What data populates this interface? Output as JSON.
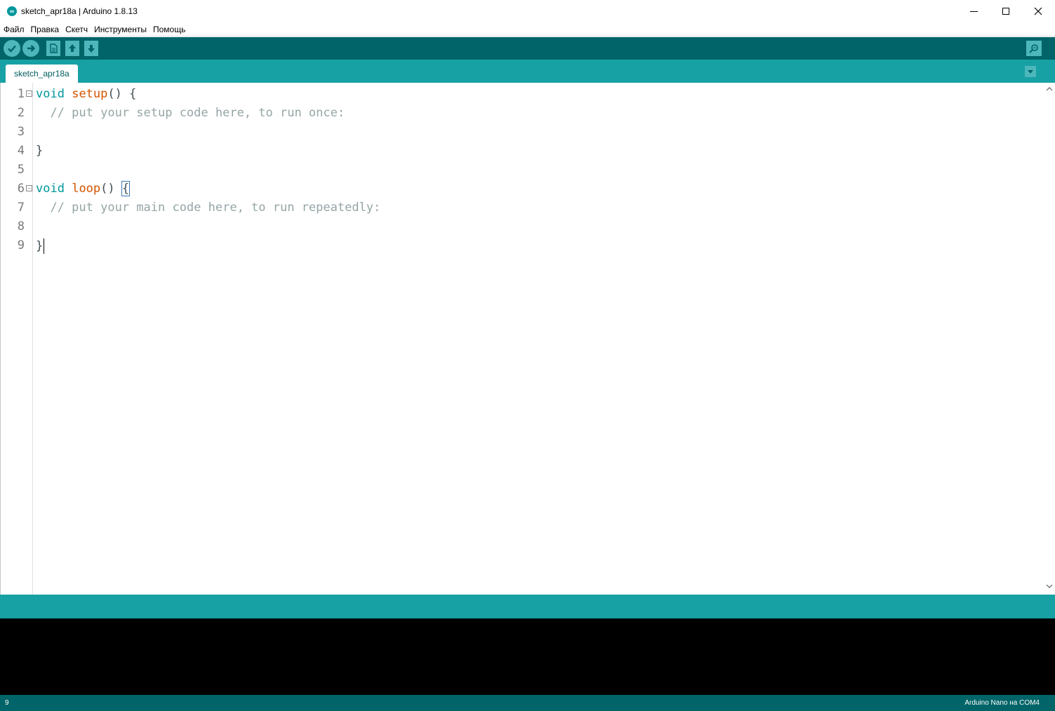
{
  "window": {
    "title": "sketch_apr18a | Arduino 1.8.13",
    "icon": "arduino-icon",
    "controls": [
      "minimize-icon",
      "maximize-icon",
      "close-icon"
    ]
  },
  "menu": {
    "items": [
      "Файл",
      "Правка",
      "Скетч",
      "Инструменты",
      "Помощь"
    ]
  },
  "toolbar": {
    "buttons": [
      "verify-icon",
      "upload-icon",
      "new-icon",
      "open-icon",
      "save-icon"
    ],
    "right_button": "serial-monitor-icon"
  },
  "tabs": {
    "items": [
      {
        "label": "sketch_apr18a",
        "active": true
      }
    ],
    "menu_icon": "tab-menu-icon"
  },
  "editor": {
    "line_numbers": [
      "1",
      "2",
      "3",
      "4",
      "5",
      "6",
      "7",
      "8",
      "9"
    ],
    "lines": {
      "l1": {
        "kw": "void",
        "fn": "setup",
        "rest": "() {"
      },
      "l2": {
        "comment": "  // put your setup code here, to run once:"
      },
      "l3": {
        "text": ""
      },
      "l4": {
        "text": "}"
      },
      "l5": {
        "text": ""
      },
      "l6": {
        "kw": "void",
        "fn": "loop",
        "rest": "() ",
        "brace": "{"
      },
      "l7": {
        "comment": "  // put your main code here, to run repeatedly:"
      },
      "l8": {
        "text": ""
      },
      "l9": {
        "text": "}"
      }
    }
  },
  "status": {
    "line": "9",
    "board": "Arduino Nano на COM4"
  },
  "colors": {
    "toolbar": "#006468",
    "tabstrip": "#17a1a5",
    "keyword": "#00979c",
    "function": "#d35400",
    "comment": "#95a5a6",
    "console": "#000000"
  }
}
